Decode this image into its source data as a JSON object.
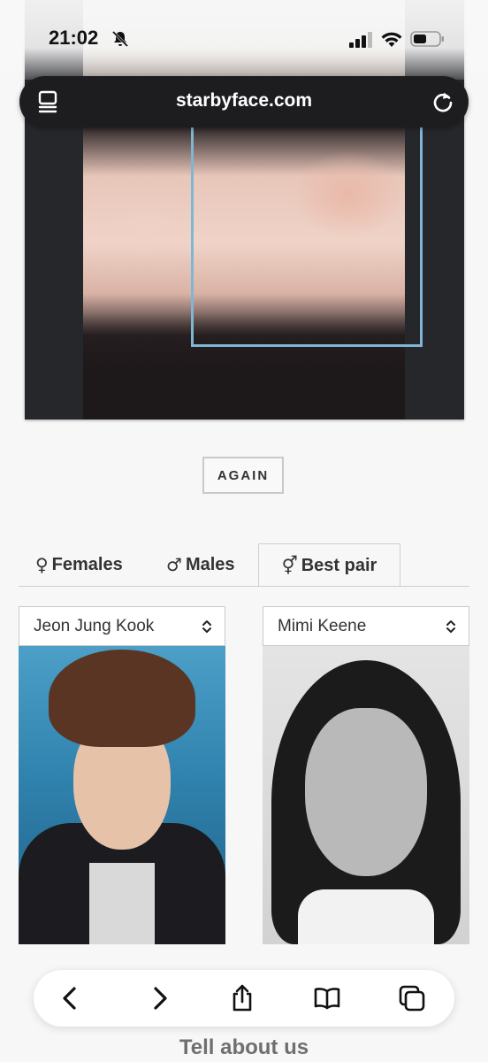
{
  "status_bar": {
    "time": "21:02"
  },
  "browser": {
    "url": "starbyface.com"
  },
  "again_button": {
    "label": "AGAIN"
  },
  "tabs": [
    {
      "symbol": "♀",
      "label": "Females"
    },
    {
      "symbol": "♂",
      "label": "Males"
    },
    {
      "symbol": "⚥",
      "label": "Best pair",
      "active": true
    }
  ],
  "matches": {
    "left": {
      "selected": "Jeon Jung Kook"
    },
    "right": {
      "selected": "Mimi Keene"
    }
  },
  "footer": {
    "title": "Tell about us"
  },
  "colors": {
    "face_box": "#7fb6d6",
    "address_bar": "#1d1d1f"
  }
}
